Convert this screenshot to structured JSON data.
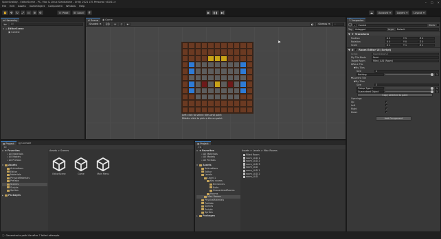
{
  "titlebar": {
    "text": "SpiceGrabby - EditorScene - PC, Mac & Linux Standalone - Unity 2021 LTS Personal <DX11>"
  },
  "menu": [
    "File",
    "Edit",
    "Assets",
    "GameObject",
    "Component",
    "Window",
    "Help"
  ],
  "toolbar": {
    "pivot": "Pivot",
    "local": "Local",
    "account": "Account",
    "layers": "Layers",
    "layout": "Layout"
  },
  "hierarchy": {
    "tab": "Hierarchy",
    "search_placeholder": "All",
    "items": [
      {
        "label": "EditorScene",
        "depth": 0,
        "bold": true
      },
      {
        "label": "Control",
        "depth": 1,
        "bold": false
      }
    ]
  },
  "scene": {
    "tabs": [
      "Scene",
      "Game"
    ],
    "shading": "Shaded",
    "gizmos": "Gizmos",
    "hint_line1": "Left click to select tiles and paint",
    "hint_line2": "Middle click to pick a tile on paint"
  },
  "grid_colors": {
    "wall": "#6b3a22",
    "floor": "#5d5d5d",
    "blue": "#2e7bd6",
    "yellow": "#c9a317",
    "dark_red": "#6e1a1a"
  },
  "grid_rows": [
    "WWWWWWWWWWW",
    "WWWWWWWWWWW",
    "WWWWYYYWWWW",
    "WBFFFFFFFBW",
    "WBFFFFFFFBW",
    "WFFFFFFFFFW",
    "WBFRFYFRFBW",
    "WBFFFFFFFBW",
    "WWFFFFFFFWW",
    "WWWWWWWWWWW",
    "WWWWWWWWWWW"
  ],
  "project": {
    "tabs": [
      "Project",
      "Console"
    ],
    "favorites_label": "Favorites",
    "favorites": [
      "All Materials",
      "All Models",
      "All Prefabs"
    ],
    "assets_label": "Assets",
    "assets": [
      "Animations",
      "Editor",
      "Materials",
      "PhysicsMaterials",
      "Prefabs",
      "Scenes",
      "Scripts",
      "Sprites"
    ],
    "packages_label": "Packages",
    "breadcrumb": "Assets > Scenes",
    "scene_files": [
      "EditorScene",
      "Game",
      "Main Menu"
    ]
  },
  "project2": {
    "tab": "Project",
    "favorites_label": "Favorites",
    "favorites": [
      "All Materials",
      "All Models",
      "All Prefabs"
    ],
    "assets_label": "Assets",
    "tree": [
      {
        "label": "Animations",
        "depth": 1
      },
      {
        "label": "Editor",
        "depth": 1
      },
      {
        "label": "Levels",
        "depth": 1
      },
      {
        "label": "Level 1",
        "depth": 2
      },
      {
        "label": "Key rooms",
        "depth": 3
      },
      {
        "label": "Entrances",
        "depth": 4
      },
      {
        "label": "Exits",
        "depth": 4
      },
      {
        "label": "GuaranteedRooms",
        "depth": 4
      },
      {
        "label": "Rooms",
        "depth": 3
      },
      {
        "label": "Misc Rooms",
        "depth": 2
      },
      {
        "label": "PhysicsMaterials",
        "depth": 1
      },
      {
        "label": "Prefabs",
        "depth": 1
      },
      {
        "label": "Scenes",
        "depth": 1
      },
      {
        "label": "Scripts",
        "depth": 1
      },
      {
        "label": "Sprites",
        "depth": 1
      }
    ],
    "packages_label": "Packages",
    "breadcrumb": "Assets > Levels > Misc Rooms",
    "files": [
      "Filled Room",
      "room_LUD 1",
      "room_LUD 2",
      "room_LUD 3",
      "room_LUD",
      "room_LUD 1",
      "room_LUD 2",
      "room_LUD"
    ]
  },
  "inspector": {
    "tab": "Inspector",
    "object_name": "Control",
    "static_label": "Static",
    "tag_label": "Tag",
    "tag_value": "Untagged",
    "layer_label": "Layer",
    "layer_value": "Default",
    "transform_label": "Transform",
    "position_label": "Position",
    "rotation_label": "Rotation",
    "scale_label": "Scale",
    "position": [
      "X 5",
      "Y 5",
      "Z 0"
    ],
    "rotation": [
      "X 0",
      "Y 0",
      "Z 0"
    ],
    "scale": [
      "X 1",
      "Y 1",
      "Z 1"
    ],
    "script_label": "Room Editor UI (Script)",
    "script_field_label": "Script",
    "script_field_value": "RoomEditorUI",
    "my_tile_mode_label": "My Tile Mode",
    "my_tile_mode_value": "Paint",
    "target_room_label": "Target Room",
    "target_room_value": "Filled_LUD (Room)",
    "paint_tile_label": "Paint Tile",
    "my_tiles_label": "My Tiles",
    "size_label": "Size",
    "size_value1": "1",
    "nothing_value": "Nothing",
    "current_tile_label": "Current Tile",
    "my_tiles2_label": "My Tiles",
    "size_value2": "2",
    "pickup_type_value": "Pickup Type 2",
    "guaranteed_value": "Guaranteed Object",
    "copy_button": "Copy selected to paint",
    "openings_label": "Openings",
    "up_label": "Up",
    "left_label": "Left",
    "right_label": "Right",
    "down_label": "Down",
    "add_component": "Add Component"
  },
  "statusbar": {
    "text": "Generated a path tile after 7 failed attempts"
  }
}
